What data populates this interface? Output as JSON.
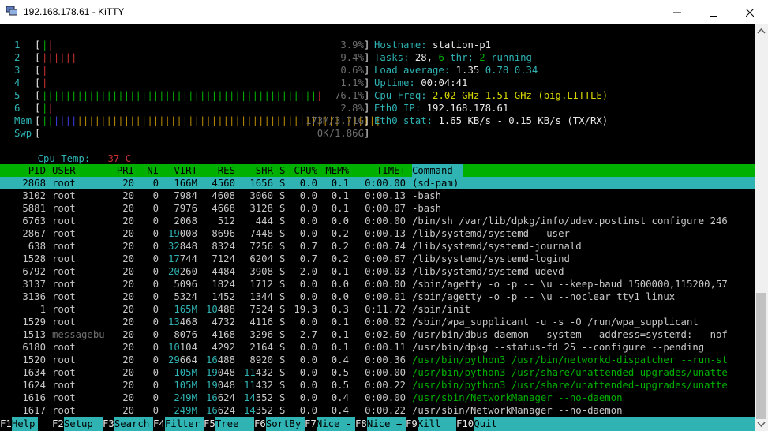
{
  "window": {
    "title": "192.168.178.61 - KiTTY",
    "minimize_icon": "minimize-icon",
    "maximize_icon": "maximize-icon",
    "close_icon": "close-icon"
  },
  "meters": [
    {
      "label": "1",
      "bar": "||",
      "bar_colors": [
        "#c83232",
        "#00b000"
      ],
      "value": "3.9%"
    },
    {
      "label": "2",
      "bar": "||||||",
      "value": "9.4%"
    },
    {
      "label": "3",
      "bar": "|",
      "value": "0.6%"
    },
    {
      "label": "4",
      "bar": "|",
      "value": "1.1%"
    },
    {
      "label": "5",
      "bar": "||||||||||||||||||||||||||||||||||||||||||||||||",
      "value": "76.1%"
    },
    {
      "label": "6",
      "bar": "||",
      "value": "2.8%"
    },
    {
      "label": "Mem",
      "bar": "||||||||||||||||||||||||||||||||||||||||||||||||||||||||||",
      "value": "173M/3.71G"
    },
    {
      "label": "Swp",
      "bar": "",
      "value": "0K/1.86G"
    }
  ],
  "cpu_temp": {
    "label": "Cpu Temp:",
    "value": "37 C"
  },
  "info": {
    "hostname_label": "Hostname:",
    "hostname": "station-p1",
    "tasks_label": "Tasks:",
    "tasks": "28,",
    "thr": "6",
    "thr_label": "thr;",
    "running": "2",
    "running_label": "running",
    "load_label": "Load average:",
    "load1": "1.35",
    "load5": "0.78",
    "load15": "0.34",
    "uptime_label": "Uptime:",
    "uptime": "00:04:41",
    "freq_label": "Cpu Freq:",
    "freq1": "2.02 GHz",
    "freq2": "1.51 GHz",
    "freq_note": "(big.LITTLE)",
    "ip_label": "Eth0 IP:",
    "ip": "192.168.178.61",
    "stat_label": "Eth0 stat:",
    "stat": "1.65 KB/s - 0.15 KB/s",
    "stat_note": "(TX/RX)"
  },
  "columns": [
    "PID",
    "USER",
    "PRI",
    "NI",
    "VIRT",
    "RES",
    "SHR",
    "S",
    "CPU%",
    "MEM%",
    "TIME+",
    "Command"
  ],
  "processes": [
    {
      "pid": "2868",
      "user": "root",
      "pri": "20",
      "ni": "0",
      "virt": "166M",
      "res": "4560",
      "shr": "1656",
      "s": "S",
      "cpu": "0.0",
      "mem": "0.1",
      "time": "0:00.00",
      "cmd": "(sd-pam)"
    },
    {
      "pid": "3102",
      "user": "root",
      "pri": "20",
      "ni": "0",
      "virt": "7984",
      "res": "4608",
      "shr": "3060",
      "s": "S",
      "cpu": "0.0",
      "mem": "0.1",
      "time": "0:00.13",
      "cmd": "-bash"
    },
    {
      "pid": "5881",
      "user": "root",
      "pri": "20",
      "ni": "0",
      "virt": "7976",
      "res": "4668",
      "shr": "3128",
      "s": "S",
      "cpu": "0.0",
      "mem": "0.1",
      "time": "0:00.07",
      "cmd": "-bash"
    },
    {
      "pid": "6763",
      "user": "root",
      "pri": "20",
      "ni": "0",
      "virt": "2068",
      "res": "512",
      "shr": "444",
      "s": "S",
      "cpu": "0.0",
      "mem": "0.0",
      "time": "0:00.00",
      "cmd": "/bin/sh /var/lib/dpkg/info/udev.postinst configure 246"
    },
    {
      "pid": "2867",
      "user": "root",
      "pri": "20",
      "ni": "0",
      "virt": "19008",
      "res": "8696",
      "shr": "7448",
      "s": "S",
      "cpu": "0.0",
      "mem": "0.2",
      "time": "0:00.13",
      "cmd": "/lib/systemd/systemd --user"
    },
    {
      "pid": "638",
      "user": "root",
      "pri": "20",
      "ni": "0",
      "virt": "32848",
      "res": "8324",
      "shr": "7256",
      "s": "S",
      "cpu": "0.7",
      "mem": "0.2",
      "time": "0:00.74",
      "cmd": "/lib/systemd/systemd-journald"
    },
    {
      "pid": "1528",
      "user": "root",
      "pri": "20",
      "ni": "0",
      "virt": "17744",
      "res": "7124",
      "shr": "6204",
      "s": "S",
      "cpu": "0.7",
      "mem": "0.2",
      "time": "0:00.67",
      "cmd": "/lib/systemd/systemd-logind"
    },
    {
      "pid": "6792",
      "user": "root",
      "pri": "20",
      "ni": "0",
      "virt": "20260",
      "res": "4484",
      "shr": "3908",
      "s": "S",
      "cpu": "2.0",
      "mem": "0.1",
      "time": "0:00.03",
      "cmd": "/lib/systemd/systemd-udevd"
    },
    {
      "pid": "3137",
      "user": "root",
      "pri": "20",
      "ni": "0",
      "virt": "5096",
      "res": "1824",
      "shr": "1712",
      "s": "S",
      "cpu": "0.0",
      "mem": "0.0",
      "time": "0:00.00",
      "cmd": "/sbin/agetty -o -p -- \\u --keep-baud 1500000,115200,57"
    },
    {
      "pid": "3136",
      "user": "root",
      "pri": "20",
      "ni": "0",
      "virt": "5324",
      "res": "1452",
      "shr": "1344",
      "s": "S",
      "cpu": "0.0",
      "mem": "0.0",
      "time": "0:00.01",
      "cmd": "/sbin/agetty -o -p -- \\u --noclear tty1 linux"
    },
    {
      "pid": "1",
      "user": "root",
      "pri": "20",
      "ni": "0",
      "virt": "165M",
      "res": "10488",
      "shr": "7524",
      "s": "S",
      "cpu": "19.3",
      "mem": "0.3",
      "time": "0:11.72",
      "cmd": "/sbin/init"
    },
    {
      "pid": "1529",
      "user": "root",
      "pri": "20",
      "ni": "0",
      "virt": "13468",
      "res": "4732",
      "shr": "4116",
      "s": "S",
      "cpu": "0.0",
      "mem": "0.1",
      "time": "0:00.02",
      "cmd": "/sbin/wpa_supplicant -u -s -O /run/wpa_supplicant"
    },
    {
      "pid": "1513",
      "user": "messagebu",
      "pri": "20",
      "ni": "0",
      "virt": "8076",
      "res": "4168",
      "shr": "3296",
      "s": "S",
      "cpu": "2.7",
      "mem": "0.1",
      "time": "0:02.60",
      "cmd": "/usr/bin/dbus-daemon --system --address=systemd: --nof"
    },
    {
      "pid": "6180",
      "user": "root",
      "pri": "20",
      "ni": "0",
      "virt": "10104",
      "res": "4292",
      "shr": "2164",
      "s": "S",
      "cpu": "0.0",
      "mem": "0.1",
      "time": "0:00.11",
      "cmd": "/usr/bin/dpkg --status-fd 25 --configure --pending"
    },
    {
      "pid": "1520",
      "user": "root",
      "pri": "20",
      "ni": "0",
      "virt": "29664",
      "res": "16488",
      "shr": "8920",
      "s": "S",
      "cpu": "0.0",
      "mem": "0.4",
      "time": "0:00.36",
      "cmd": "/usr/bin/python3 /usr/bin/networkd-dispatcher --run-st"
    },
    {
      "pid": "1634",
      "user": "root",
      "pri": "20",
      "ni": "0",
      "virt": "105M",
      "res": "19048",
      "shr": "11432",
      "s": "S",
      "cpu": "0.0",
      "mem": "0.5",
      "time": "0:00.00",
      "cmd": "/usr/bin/python3 /usr/share/unattended-upgrades/unatte"
    },
    {
      "pid": "1624",
      "user": "root",
      "pri": "20",
      "ni": "0",
      "virt": "105M",
      "res": "19048",
      "shr": "11432",
      "s": "S",
      "cpu": "0.0",
      "mem": "0.5",
      "time": "0:00.22",
      "cmd": "/usr/bin/python3 /usr/share/unattended-upgrades/unatte"
    },
    {
      "pid": "1616",
      "user": "root",
      "pri": "20",
      "ni": "0",
      "virt": "249M",
      "res": "16624",
      "shr": "14352",
      "s": "S",
      "cpu": "0.0",
      "mem": "0.4",
      "time": "0:00.00",
      "cmd": "/usr/sbin/NetworkManager --no-daemon"
    },
    {
      "pid": "1617",
      "user": "root",
      "pri": "20",
      "ni": "0",
      "virt": "249M",
      "res": "16624",
      "shr": "14352",
      "s": "S",
      "cpu": "0.0",
      "mem": "0.4",
      "time": "0:00.22",
      "cmd": "/usr/sbin/NetworkManager --no-daemon"
    }
  ],
  "thread_rows": [
    14,
    15,
    16,
    17
  ],
  "function_keys": [
    {
      "key": "F1",
      "label": "Help"
    },
    {
      "key": "F2",
      "label": "Setup"
    },
    {
      "key": "F3",
      "label": "Search"
    },
    {
      "key": "F4",
      "label": "Filter"
    },
    {
      "key": "F5",
      "label": "Tree"
    },
    {
      "key": "F6",
      "label": "SortBy"
    },
    {
      "key": "F7",
      "label": "Nice -"
    },
    {
      "key": "F8",
      "label": "Nice +"
    },
    {
      "key": "F9",
      "label": "Kill"
    },
    {
      "key": "F10",
      "label": "Quit"
    }
  ],
  "colors": {
    "cyan": "#2fb3b3",
    "green": "#00b000",
    "red": "#c83232",
    "yellow": "#d7d700"
  }
}
